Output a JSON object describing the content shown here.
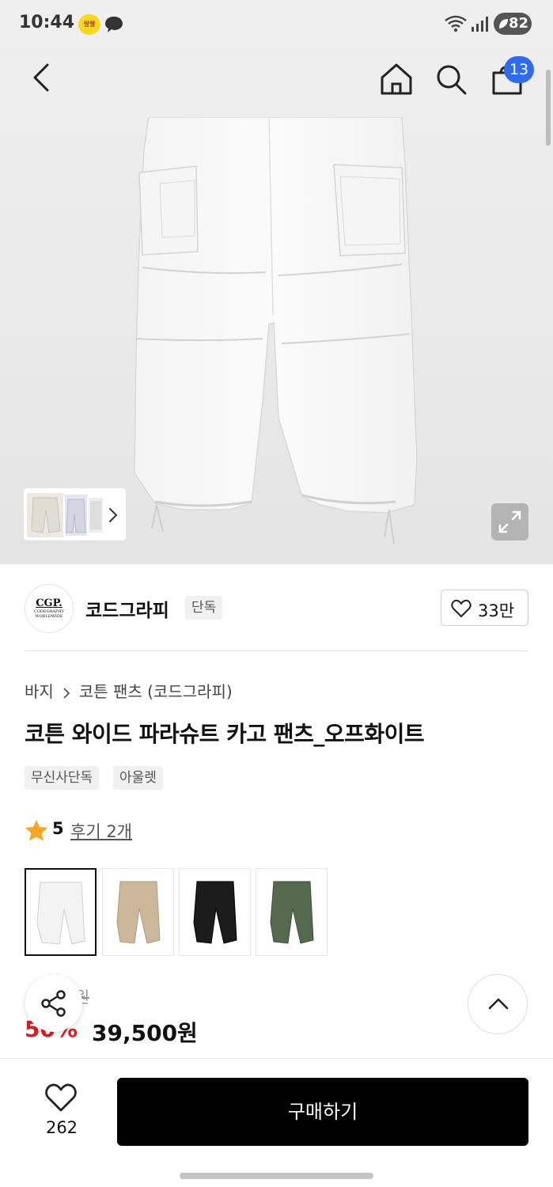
{
  "status_bar": {
    "time": "10:44",
    "app_badge": "쌍쌍",
    "battery": "82"
  },
  "header": {
    "cart_count": "13"
  },
  "brand": {
    "logo_text": "CGP.",
    "logo_subtext": "CODEGRAPHY WORLDWIDE",
    "name": "코드그라피",
    "tag": "단독",
    "like_count": "33만"
  },
  "product": {
    "breadcrumb": [
      "바지",
      "코튼 팬츠 (코드그라피)"
    ],
    "title": "코튼 와이드 파라슈트 카고 팬츠_오프화이트",
    "tags": [
      "무신사단독",
      "아울렛"
    ],
    "rating": "5",
    "reviews_label": "후기 2개",
    "color_options": [
      {
        "name": "off-white",
        "color": "#f1f1f1",
        "selected": true
      },
      {
        "name": "beige",
        "color": "#cdb79a",
        "selected": false
      },
      {
        "name": "black",
        "color": "#1c1c1c",
        "selected": false
      },
      {
        "name": "khaki",
        "color": "#55694d",
        "selected": false
      }
    ],
    "original_price_visible": "0원",
    "discount_visible": "50%",
    "price": "39,500원"
  },
  "bottom_bar": {
    "wish_count": "262",
    "buy_label": "구매하기"
  },
  "colors": {
    "accent_blue": "#2f6bf0",
    "discount_red": "#e8171f",
    "star_yellow": "#f5a623"
  },
  "icons": {
    "back": "chevron-left-icon",
    "home": "home-icon",
    "search": "search-icon",
    "cart": "shopping-bag-icon",
    "expand": "expand-icon",
    "heart": "heart-icon",
    "star": "star-icon",
    "share": "share-icon",
    "scroll_top": "chevron-up-icon"
  }
}
